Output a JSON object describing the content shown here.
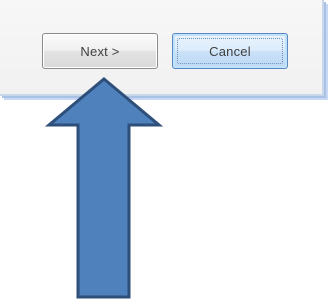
{
  "dialog": {
    "buttons": {
      "next_label": "Next >",
      "cancel_label": "Cancel"
    }
  },
  "annotation": {
    "arrow_icon": "up-arrow-icon",
    "arrow_fill": "#4f81bd",
    "arrow_stroke": "#2e4f7a"
  }
}
